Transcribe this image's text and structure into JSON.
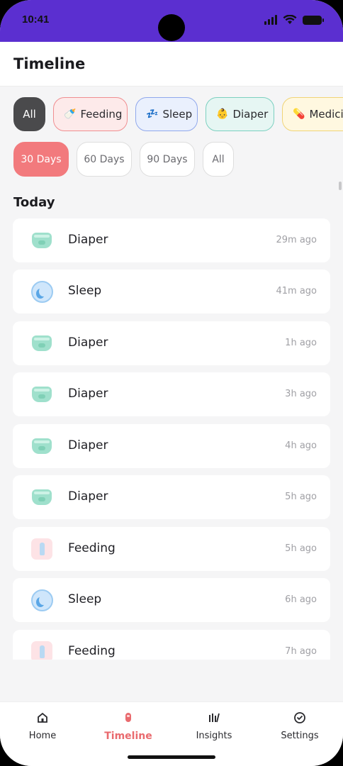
{
  "status_bar": {
    "time": "10:41"
  },
  "app_bar": {
    "title": "Timeline"
  },
  "filters": {
    "categories": [
      {
        "label": "All",
        "emoji": ""
      },
      {
        "label": "Feeding",
        "emoji": "🍼"
      },
      {
        "label": "Sleep",
        "emoji": "💤"
      },
      {
        "label": "Diaper",
        "emoji": "👶"
      },
      {
        "label": "Medicine",
        "emoji": "💊"
      }
    ],
    "ranges": [
      "30 Days",
      "60 Days",
      "90 Days",
      "All"
    ],
    "selected_category": "All",
    "selected_range": "30 Days"
  },
  "section": {
    "title": "Today"
  },
  "events": [
    {
      "type": "diaper",
      "label": "Diaper",
      "time": "29m ago"
    },
    {
      "type": "sleep",
      "label": "Sleep",
      "time": "41m ago"
    },
    {
      "type": "diaper",
      "label": "Diaper",
      "time": "1h ago"
    },
    {
      "type": "diaper",
      "label": "Diaper",
      "time": "3h ago"
    },
    {
      "type": "diaper",
      "label": "Diaper",
      "time": "4h ago"
    },
    {
      "type": "diaper",
      "label": "Diaper",
      "time": "5h ago"
    },
    {
      "type": "feeding",
      "label": "Feeding",
      "time": "5h ago"
    },
    {
      "type": "sleep",
      "label": "Sleep",
      "time": "6h ago"
    },
    {
      "type": "feeding",
      "label": "Feeding",
      "time": "7h ago"
    }
  ],
  "bottom_nav": [
    {
      "label": "Home",
      "icon": "home-icon"
    },
    {
      "label": "Timeline",
      "icon": "timeline-icon",
      "active": true
    },
    {
      "label": "Insights",
      "icon": "insights-icon"
    },
    {
      "label": "Settings",
      "icon": "settings-icon"
    }
  ],
  "colors": {
    "status_bar": "#5b2fd0",
    "accent": "#f27a7d",
    "feeding": "#f08e91",
    "sleep": "#90a8ec",
    "diaper": "#7cd0c0",
    "medicine": "#f0d477"
  }
}
